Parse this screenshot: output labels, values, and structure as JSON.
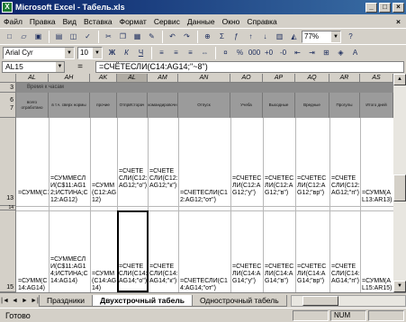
{
  "window": {
    "title": "Microsoft Excel - Табель.xls",
    "icon": "excel-icon",
    "controls": [
      "_",
      "□",
      "×"
    ]
  },
  "menu": {
    "items": [
      "Файл",
      "Правка",
      "Вид",
      "Вставка",
      "Формат",
      "Сервис",
      "Данные",
      "Окно",
      "Справка"
    ],
    "doc_close": "×"
  },
  "toolbar1": {
    "buttons": [
      "new-icon",
      "open-icon",
      "save-icon",
      "print-icon",
      "preview-icon",
      "spell-icon",
      "cut-icon",
      "copy-icon",
      "paste-icon",
      "format-painter-icon",
      "undo-icon",
      "redo-icon",
      "hyperlink-icon",
      "autosum-icon",
      "function-icon",
      "sort-asc-icon",
      "sort-desc-icon",
      "chart-wizard-icon",
      "drawing-icon"
    ],
    "zoom": "77%",
    "help": "?"
  },
  "toolbar2": {
    "font": "Arial Cyr",
    "size": "10",
    "bold": "Ж",
    "italic": "К",
    "underline": "Ч",
    "buttons": [
      "align-left-icon",
      "align-center-icon",
      "align-right-icon",
      "merge-center-icon",
      "currency-icon",
      "percent-icon",
      "thousands-icon",
      "inc-decimal-icon",
      "dec-decimal-icon",
      "dec-indent-icon",
      "inc-indent-icon",
      "borders-icon",
      "fill-color-icon",
      "font-color-icon"
    ]
  },
  "formula_bar": {
    "name_box": "AL15",
    "eq": "=",
    "formula": "=СЧЁТЕСЛИ(C14:AG14;\"~8\")"
  },
  "columns": [
    "AL",
    "AH",
    "AK",
    "AL",
    "AM",
    "AN",
    "AO",
    "AP",
    "AQ",
    "AR",
    "AS"
  ],
  "selected_column": "AL",
  "rows": {
    "r3": "3",
    "r6": "6",
    "r7": "7",
    "r13": "13",
    "r14": "14",
    "r15": "15"
  },
  "row3_text": "Время к часам",
  "header_cells": [
    "всего отработано",
    "в т.ч. сверх нормы",
    "прочие",
    "ОтпрИсторач",
    "командировочн",
    "Отпуск",
    "Учеба",
    "Выходные",
    "Вредные",
    "Прогулы",
    "Итого дней"
  ],
  "row13": [
    "=СУММ(C12:AG12)",
    "=СУММЕСЛИ(C$11:AG12;ИСТИНА;C12:AG12)",
    "=СУММ(C12:AG12)",
    "=СЧЁТЕСЛИ(C12:AG12;\"о\")",
    "=СЧЁТЕСЛИ(C12:AG12;\"к\")",
    "=СЧЁТЕСЛИ(C12:AG12;\"от\")",
    "=СЧЁТЕСЛИ(C12:AG12;\"у\")",
    "=СЧЁТЕСЛИ(C12:AG12;\"в\")",
    "=СЧЁТЕСЛИ(C12:AG12;\"вр\")",
    "=СЧЁТЕСЛИ(C12:AG12;\"п\")",
    "=СУММ(AL13:AR13)"
  ],
  "row15": [
    "=СУММ(C14:AG14)",
    "=СУММЕСЛИ(C$11:AG14;ИСТИНА;C14:AG14)",
    "=СУММ(C14:AG14)",
    "=СЧЁТЕСЛИ(C14:AG14;\"о\")",
    "=СЧЁТЕСЛИ(C14:AG14;\"к\")",
    "=СЧЁТЕСЛИ(C14:AG14;\"от\")",
    "=СЧЁТЕСЛИ(C14:AG14;\"у\")",
    "=СЧЁТЕСЛИ(C14:AG14;\"в\")",
    "=СЧЁТЕСЛИ(C14:AG14;\"вр\")",
    "=СЧЁТЕСЛИ(C14:AG14;\"п\")",
    "=СУММ(AL15:AR15)"
  ],
  "sheet_tabs": [
    "Праздники",
    "Двухстрочный табель",
    "Однострочный табель"
  ],
  "active_tab": 1,
  "status": {
    "text": "Готово",
    "num": "NUM"
  }
}
